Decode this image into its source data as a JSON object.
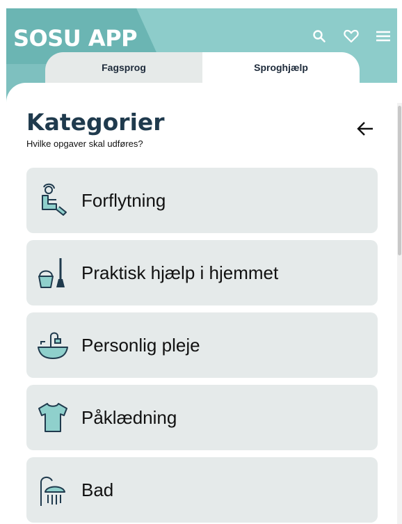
{
  "header": {
    "app_title": "SOSU APP"
  },
  "top_icons": [
    "search-icon",
    "heart-icon",
    "menu-icon"
  ],
  "tabs": [
    {
      "label": "Fagsprog",
      "active": false
    },
    {
      "label": "Sproghjælp",
      "active": true
    }
  ],
  "main": {
    "heading": "Kategorier",
    "subheading": "Hvilke opgaver skal udføres?"
  },
  "categories": [
    {
      "label": "Forflytning",
      "icon": "person-transfer-icon"
    },
    {
      "label": "Praktisk hjælp i hjemmet",
      "icon": "bucket-broom-icon"
    },
    {
      "label": "Personlig pleje",
      "icon": "sink-icon"
    },
    {
      "label": "Påklædning",
      "icon": "tshirt-icon"
    },
    {
      "label": "Bad",
      "icon": "shower-icon"
    }
  ],
  "colors": {
    "header": "#7ec0bf",
    "heading": "#1f3a4d",
    "card": "#e5eaea",
    "icon_stroke": "#1f3a4d",
    "icon_fill": "#8fd0cc"
  }
}
